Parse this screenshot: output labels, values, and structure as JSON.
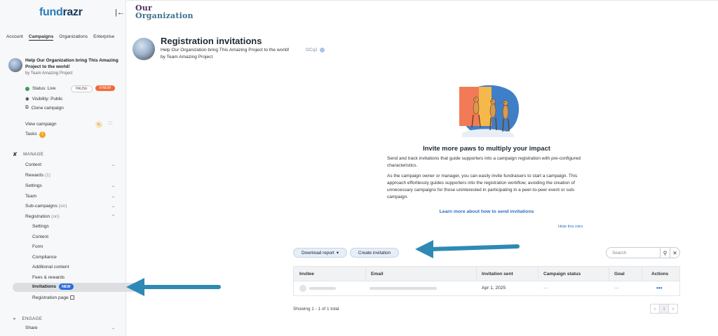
{
  "sidebar": {
    "logo_main": "fund",
    "logo_accent": "razr",
    "tabs": [
      "Account",
      "Campaigns",
      "Organizations",
      "Enterprise"
    ],
    "campaign": {
      "title": "Help Our Organization bring This Amazing Project to the world!",
      "by": "by Team Amazing Project",
      "status": "Status: Live",
      "pause_label": "PAUSE",
      "finish_label": "FINISH",
      "visibility": "Visibility: Public",
      "clone": "Clone campaign"
    },
    "view_campaign": "View campaign",
    "tasks": "Tasks",
    "tasks_count": "1",
    "manage_heading": "MANAGE",
    "manage_items": [
      {
        "label": "Content",
        "extra": ""
      },
      {
        "label": "Rewards",
        "extra": "(1)"
      },
      {
        "label": "Settings",
        "extra": ""
      },
      {
        "label": "Team",
        "extra": ""
      },
      {
        "label": "Sub-campaigns",
        "extra": "(on)"
      },
      {
        "label": "Registration",
        "extra": "(on)"
      }
    ],
    "registration_sub": [
      "Settings",
      "Content",
      "Form",
      "Compliance",
      "Additional content",
      "Fees & rewards"
    ],
    "active_item": "Invitations",
    "new_badge": "NEW",
    "registration_page": "Registration page",
    "engage_heading": "ENGAGE",
    "engage_items": [
      {
        "label": "Share"
      }
    ]
  },
  "org_logo": {
    "line1": "Our",
    "line2": "Organization"
  },
  "header": {
    "title": "Registration invitations",
    "subtitle": "Help Our Organization bring This Amazing Project to the world!",
    "code": "f2Cq2",
    "by": "by Team Amazing Project"
  },
  "intro": {
    "heading": "Invite more paws to multiply your impact",
    "p1": "Send and track invitations that guide supporters into a campaign registration with pre-configured characteristics.",
    "p2": "As the campaign owner or manager, you can easily invite fundraisers to start a campaign. This approach effortlessly guides supporters into the registration workflow, avoiding the creation of unnecessary campaigns for those uninterested in participating in a peer-to-peer event or sub-campaign.",
    "learn_more": "Learn more about how to send invitations",
    "hide": "Hide this intro"
  },
  "toolbar": {
    "download_label": "Download report",
    "create_label": "Create invitation",
    "search_placeholder": "Search"
  },
  "table": {
    "columns": [
      "Invitee",
      "Email",
      "Invitation sent",
      "Campaign status",
      "Goal",
      "Actions"
    ],
    "rows": [
      {
        "invitation_sent": "Apr 1, 2025",
        "campaign_status": "—",
        "goal": "—",
        "actions": "•••"
      }
    ],
    "showing": "Showing 1 - 1 of 1 total",
    "page": "1"
  },
  "colors": {
    "accent": "#2a6fc0",
    "finish": "#f26b3a",
    "new_badge": "#2a6fdb",
    "annotation_arrow": "#2e8ab5"
  }
}
